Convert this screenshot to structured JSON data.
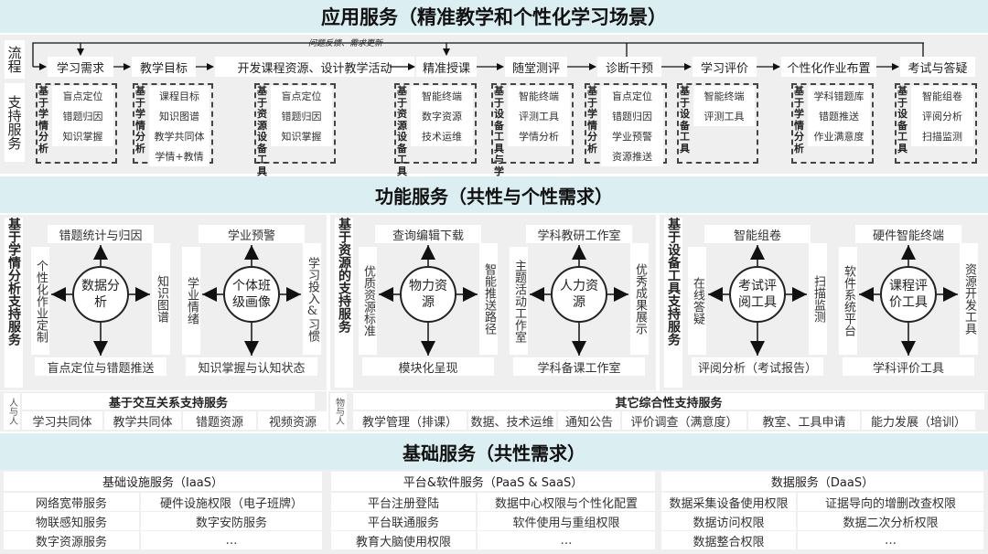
{
  "application": {
    "title": "应用服务（精准教学和个性化学习场景）",
    "flow_label": "流程",
    "feedback_label": "问题反馈、需求更新",
    "steps": [
      "学习需求",
      "教学目标",
      "开发课程资源、设计教学活动",
      "精准授课",
      "随堂测评",
      "诊断干预",
      "学习评价",
      "个性化作业布置",
      "考试与答疑"
    ],
    "support_label": "支持服务",
    "support_groups": [
      {
        "label": "基于学情分析",
        "items": [
          "盲点定位",
          "错题归因",
          "知识掌握"
        ]
      },
      {
        "label": "基于学情分析",
        "items": [
          "课程目标",
          "知识图谱",
          "教学共同体",
          "学情+教情"
        ]
      },
      {
        "label": "基于资源设备工具",
        "items": [
          "盲点定位",
          "错题归因",
          "知识掌握"
        ]
      },
      {
        "label": "基于资源设备工具",
        "items": [
          "智能终端",
          "数字资源",
          "技术运维"
        ]
      },
      {
        "label": "基于设备工具与学情分析",
        "items": [
          "智能终端",
          "评测工具",
          "学情分析"
        ]
      },
      {
        "label": "基于学情分析",
        "items": [
          "盲点定位",
          "错题归因",
          "学业预警",
          "资源推送"
        ]
      },
      {
        "label": "基于设备工具",
        "items": [
          "智能终端",
          "评测工具"
        ]
      },
      {
        "label": "基于学情分析",
        "items": [
          "学科错题库",
          "错题推送",
          "作业满意度"
        ]
      },
      {
        "label": "基于设备工具",
        "items": [
          "智能组卷",
          "评阅分析",
          "扫描监测"
        ]
      }
    ]
  },
  "functional": {
    "title": "功能服务（共性与个性需求）",
    "panels": [
      {
        "label": "基于学情分析支持服务",
        "hubs": [
          {
            "center": "数据分析",
            "top": "错题统计与归因",
            "bottom": "盲点定位与错题推送",
            "left": "个性化作业定制",
            "right": "知识图谱"
          },
          {
            "center": "个体班级画像",
            "top": "学业预警",
            "bottom": "知识掌握与认知状态",
            "left": "学业情绪",
            "right": "学习投入&习惯"
          }
        ]
      },
      {
        "label": "基于资源的支持服务",
        "hubs": [
          {
            "center": "物力资源",
            "top": "查询编辑下载",
            "bottom": "模块化呈现",
            "left": "优质资源标准",
            "right": "智能推送路径"
          },
          {
            "center": "人力资源",
            "top": "学科教研工作室",
            "bottom": "学科备课工作室",
            "left": "主题活动工作室",
            "right": "优秀成果展示"
          }
        ]
      },
      {
        "label": "基于设备工具支持服务",
        "hubs": [
          {
            "center": "考试评阅工具",
            "top": "智能组卷",
            "bottom": "评阅分析（考试报告）",
            "left": "在线答疑",
            "right": "扫描监测"
          },
          {
            "center": "课程评价工具",
            "top": "硬件智能终端",
            "bottom": "学科评价工具",
            "left": "软件系统平台",
            "right": "资源开发工具"
          }
        ]
      }
    ],
    "interaction": {
      "side_label": "人与人",
      "title": "基于交互关系支持服务",
      "items": [
        "学习共同体",
        "教学共同体",
        "错题资源",
        "视频资源"
      ]
    },
    "other": {
      "side_label": "物与人",
      "title": "其它综合性支持服务",
      "items": [
        "教学管理（排课）",
        "数据、技术运维",
        "通知公告",
        "评价调查（满意度）",
        "教室、工具申请",
        "能力发展（培训）"
      ]
    }
  },
  "foundation": {
    "title": "基础服务（共性需求）",
    "columns": [
      {
        "title": "基础设施服务（IaaS）",
        "rows": [
          [
            "网络宽带服务",
            "硬件设施权限（电子班牌）"
          ],
          [
            "物联感知服务",
            "数字安防服务"
          ],
          [
            "数字资源服务",
            "…"
          ]
        ]
      },
      {
        "title": "平台&软件服务（PaaS & SaaS）",
        "rows": [
          [
            "平台注册登陆",
            "数据中心权限与个性化配置"
          ],
          [
            "平台联通服务",
            "软件使用与重组权限"
          ],
          [
            "教育大脑使用权限",
            "…"
          ]
        ]
      },
      {
        "title": "数据服务（DaaS）",
        "rows": [
          [
            "数据采集设备使用权限",
            "证据导向的增删改查权限"
          ],
          [
            "数据访问权限",
            "数据二次分析权限"
          ],
          [
            "数据整合权限",
            "…"
          ]
        ]
      }
    ]
  },
  "colors": {
    "band": "#dbeef2",
    "panel": "#efefef",
    "line": "#222222"
  }
}
